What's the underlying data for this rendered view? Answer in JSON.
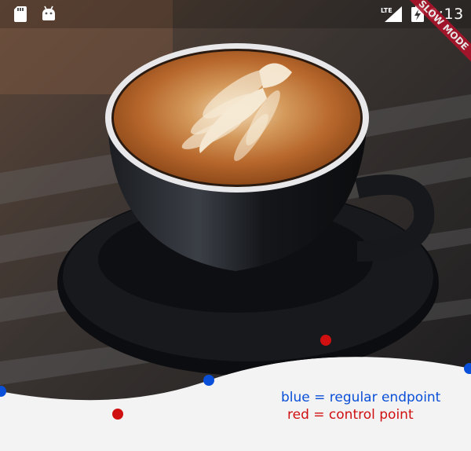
{
  "status_bar": {
    "time": "8:13",
    "icons": [
      "sd-card-icon",
      "android-icon",
      "lte-signal-icon",
      "battery-charging-icon"
    ]
  },
  "debug_banner": {
    "label": "SLOW MODE",
    "color": "#b0122a"
  },
  "photo": {
    "subject": "latte-art-cup-photo"
  },
  "legend": {
    "blue_text": "blue = regular endpoint",
    "red_text": "red = control point",
    "blue_color": "#0a4fd8",
    "red_color": "#d01010"
  },
  "bezier_points": {
    "endpoints": [
      {
        "type": "regular endpoint",
        "color": "#0a4fd8"
      },
      {
        "type": "regular endpoint",
        "color": "#0a4fd8"
      },
      {
        "type": "regular endpoint",
        "color": "#0a4fd8"
      }
    ],
    "control_points": [
      {
        "type": "control point",
        "color": "#d01010"
      },
      {
        "type": "control point",
        "color": "#d01010"
      }
    ]
  }
}
